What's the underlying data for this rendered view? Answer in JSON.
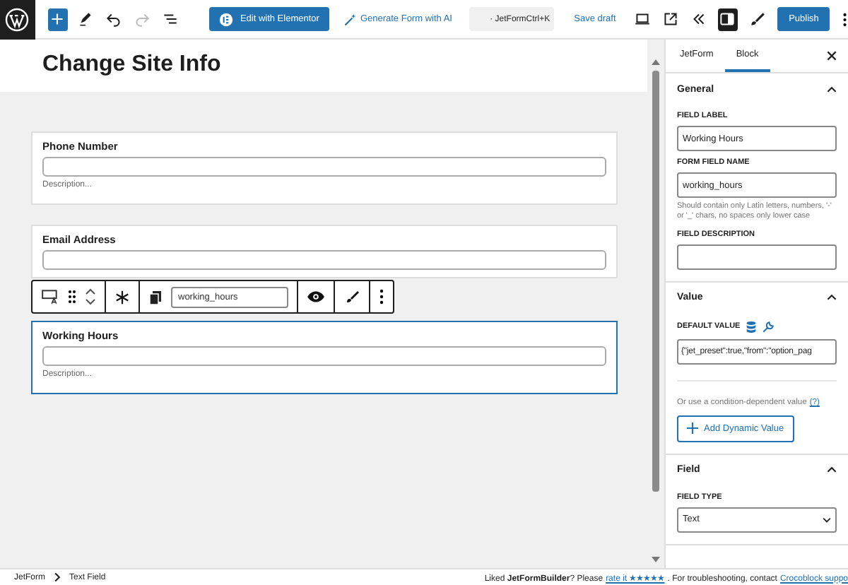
{
  "topbar": {
    "tools": [
      {
        "kind": "add",
        "disabled": false
      },
      {
        "kind": "pen",
        "disabled": false
      },
      {
        "kind": "undo",
        "disabled": false
      },
      {
        "kind": "redo",
        "disabled": true
      },
      {
        "kind": "list",
        "disabled": false
      }
    ],
    "elementor_button": "Edit with Elementor",
    "ai_link": "Generate Form with AI",
    "command": "· JetFormCtrl+K",
    "save_draft": "Save draft",
    "actions": [
      {
        "kind": "desktop",
        "pressed": false
      },
      {
        "kind": "external",
        "pressed": false
      },
      {
        "kind": "chevrons",
        "pressed": false
      },
      {
        "kind": "sidebar",
        "pressed": true
      },
      {
        "kind": "brush",
        "pressed": false
      }
    ],
    "publish": "Publish"
  },
  "page_title": "Change Site Info",
  "fields": [
    {
      "label": "Phone Number",
      "description": "Description...",
      "selected": false
    },
    {
      "label": "Email Address",
      "selected": false
    },
    {
      "label": "Working Hours",
      "description": "Description...",
      "selected": true
    }
  ],
  "block_toolbar": {
    "name_value": "working_hours",
    "required": true
  },
  "sidebar": {
    "tabs": [
      {
        "label": "JetForm",
        "selected": false
      },
      {
        "label": "Block",
        "selected": true
      }
    ],
    "sections": [
      {
        "title": "General",
        "expanded": true,
        "items": [
          {
            "kind": "input",
            "label": "FIELD LABEL",
            "value": "Working Hours"
          },
          {
            "kind": "input",
            "label": "FORM FIELD NAME",
            "value": "working_hours",
            "help": "Should contain only Latin letters, numbers, '-' or '_' chars, no spaces only lower case"
          },
          {
            "kind": "input",
            "label": "FIELD DESCRIPTION"
          }
        ]
      },
      {
        "title": "Value",
        "expanded": true,
        "items": [
          {
            "kind": "preset",
            "label": "DEFAULT VALUE",
            "value": "{\"jet_preset\":true,\"from\":\"option_pag"
          },
          {
            "kind": "dynamic",
            "text": "Or use a condition-dependent value",
            "help_link": "(?)",
            "button": "Add Dynamic Value"
          }
        ]
      },
      {
        "title": "Field",
        "expanded": true,
        "items": [
          {
            "kind": "select",
            "label": "FIELD TYPE",
            "value": "Text"
          }
        ]
      }
    ]
  },
  "footer": {
    "breadcrumbs": [
      "JetForm",
      "Text Field"
    ],
    "message": "Liked **JetFormBuilder**? Please",
    "rate_link": "rate it ★★★★★",
    "middle": ". For troubleshooting, contact",
    "support_link": "Crocoblock suppo"
  }
}
